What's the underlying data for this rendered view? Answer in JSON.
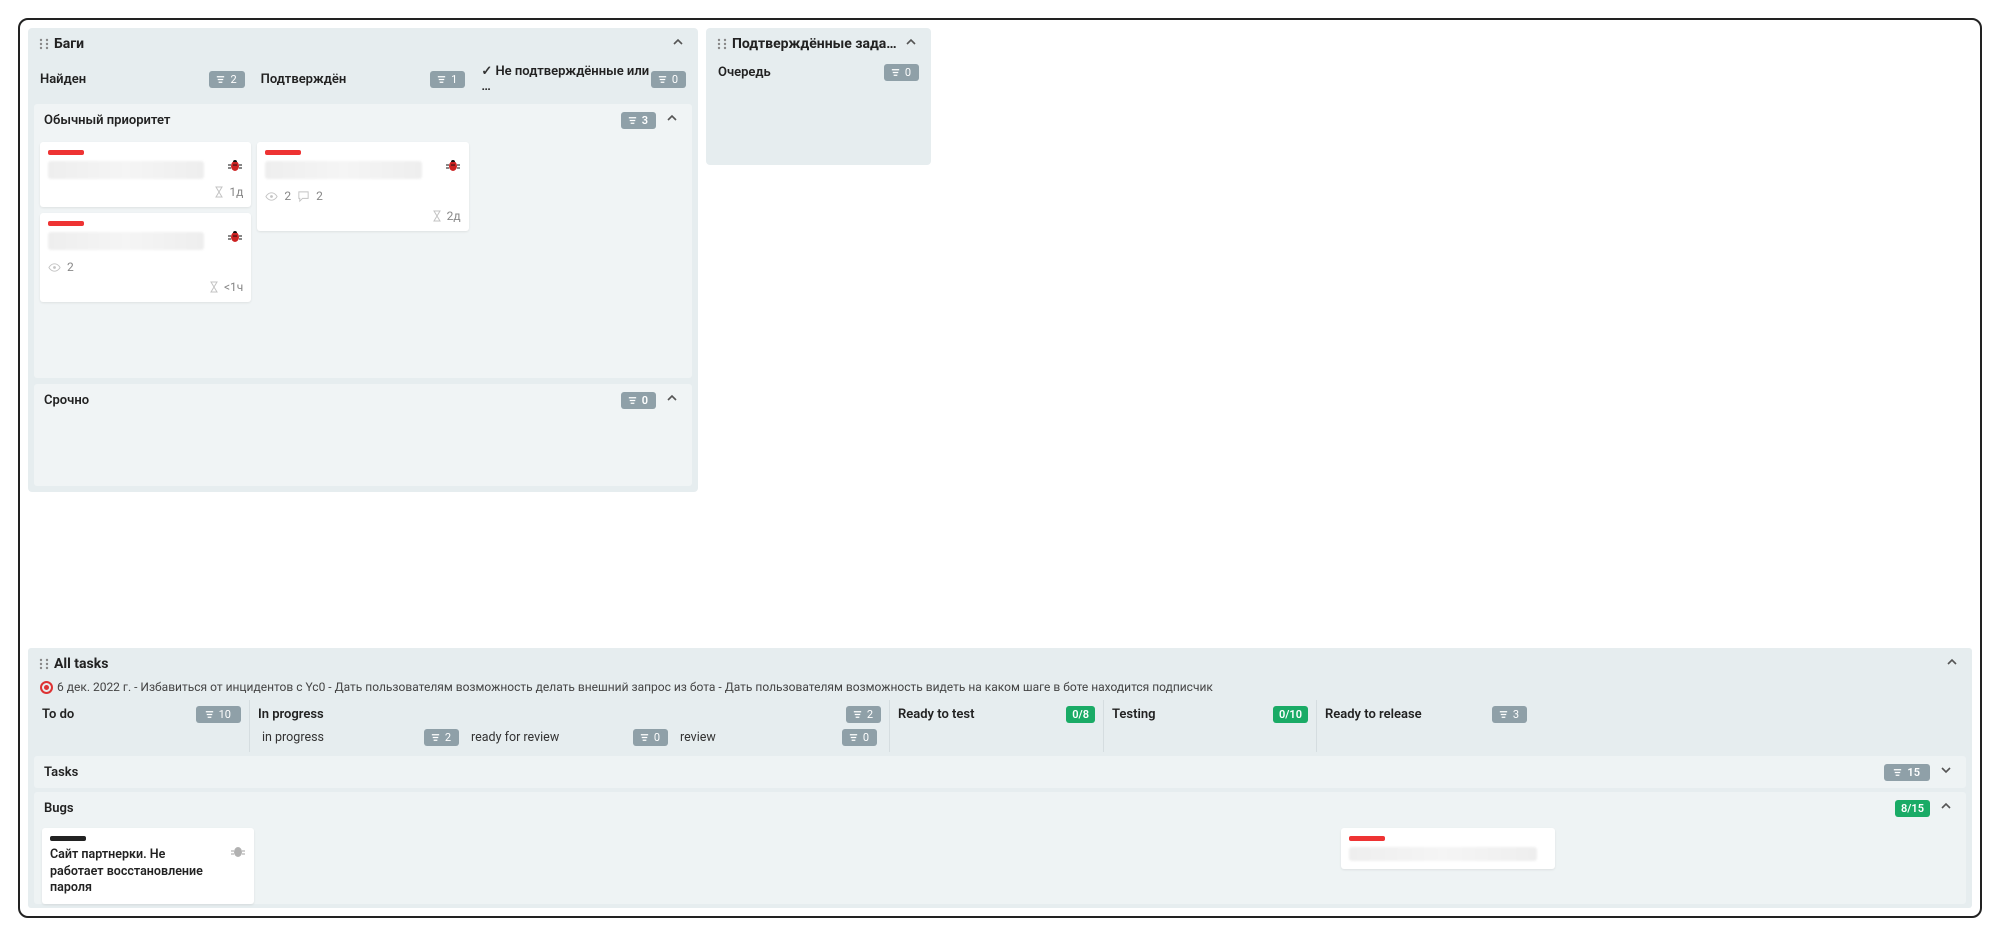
{
  "panels": {
    "bugs": {
      "title": "Баги",
      "columns": [
        {
          "label": "Найден",
          "count": "2"
        },
        {
          "label": "Подтверждён",
          "count": "1"
        },
        {
          "label": "Не подтверждённые или …",
          "count": "0",
          "checked": true
        }
      ],
      "swimlanes": {
        "normal": {
          "title": "Обычный приоритет",
          "count": "3",
          "cards_found": [
            {
              "time": "1д"
            },
            {
              "time": "<1ч",
              "views": "2"
            }
          ],
          "cards_confirmed": [
            {
              "time": "2д",
              "views": "2",
              "comments": "2"
            }
          ]
        },
        "urgent": {
          "title": "Срочно",
          "count": "0"
        }
      }
    },
    "approved": {
      "title": "Подтверждённые задачи (н…",
      "columns": [
        {
          "label": "Очередь",
          "count": "0"
        }
      ]
    }
  },
  "all_tasks": {
    "title": "All tasks",
    "goal": "6 дек. 2022 г. - Избавиться от инцидентов с Yc0 - Дать пользователям возможность делать внешний запрос из бота - Дать пользователям возможность видеть на каком шаге в боте находится подписчик",
    "columns": {
      "todo": {
        "label": "To do",
        "count": "10"
      },
      "in_progress": {
        "label": "In progress",
        "count": "2",
        "subs": [
          {
            "label": "in progress",
            "count": "2"
          },
          {
            "label": "ready for review",
            "count": "0"
          },
          {
            "label": "review",
            "count": "0"
          }
        ]
      },
      "ready_to_test": {
        "label": "Ready to test",
        "ratio": "0/8"
      },
      "testing": {
        "label": "Testing",
        "ratio": "0/10"
      },
      "ready_to_release": {
        "label": "Ready to release",
        "count": "3"
      }
    },
    "swimlanes": {
      "tasks": {
        "title": "Tasks",
        "count": "15"
      },
      "bugs": {
        "title": "Bugs",
        "ratio": "8/15",
        "card_todo": {
          "title": "Сайт партнерки. Не работает восстановление пароля"
        }
      }
    }
  }
}
